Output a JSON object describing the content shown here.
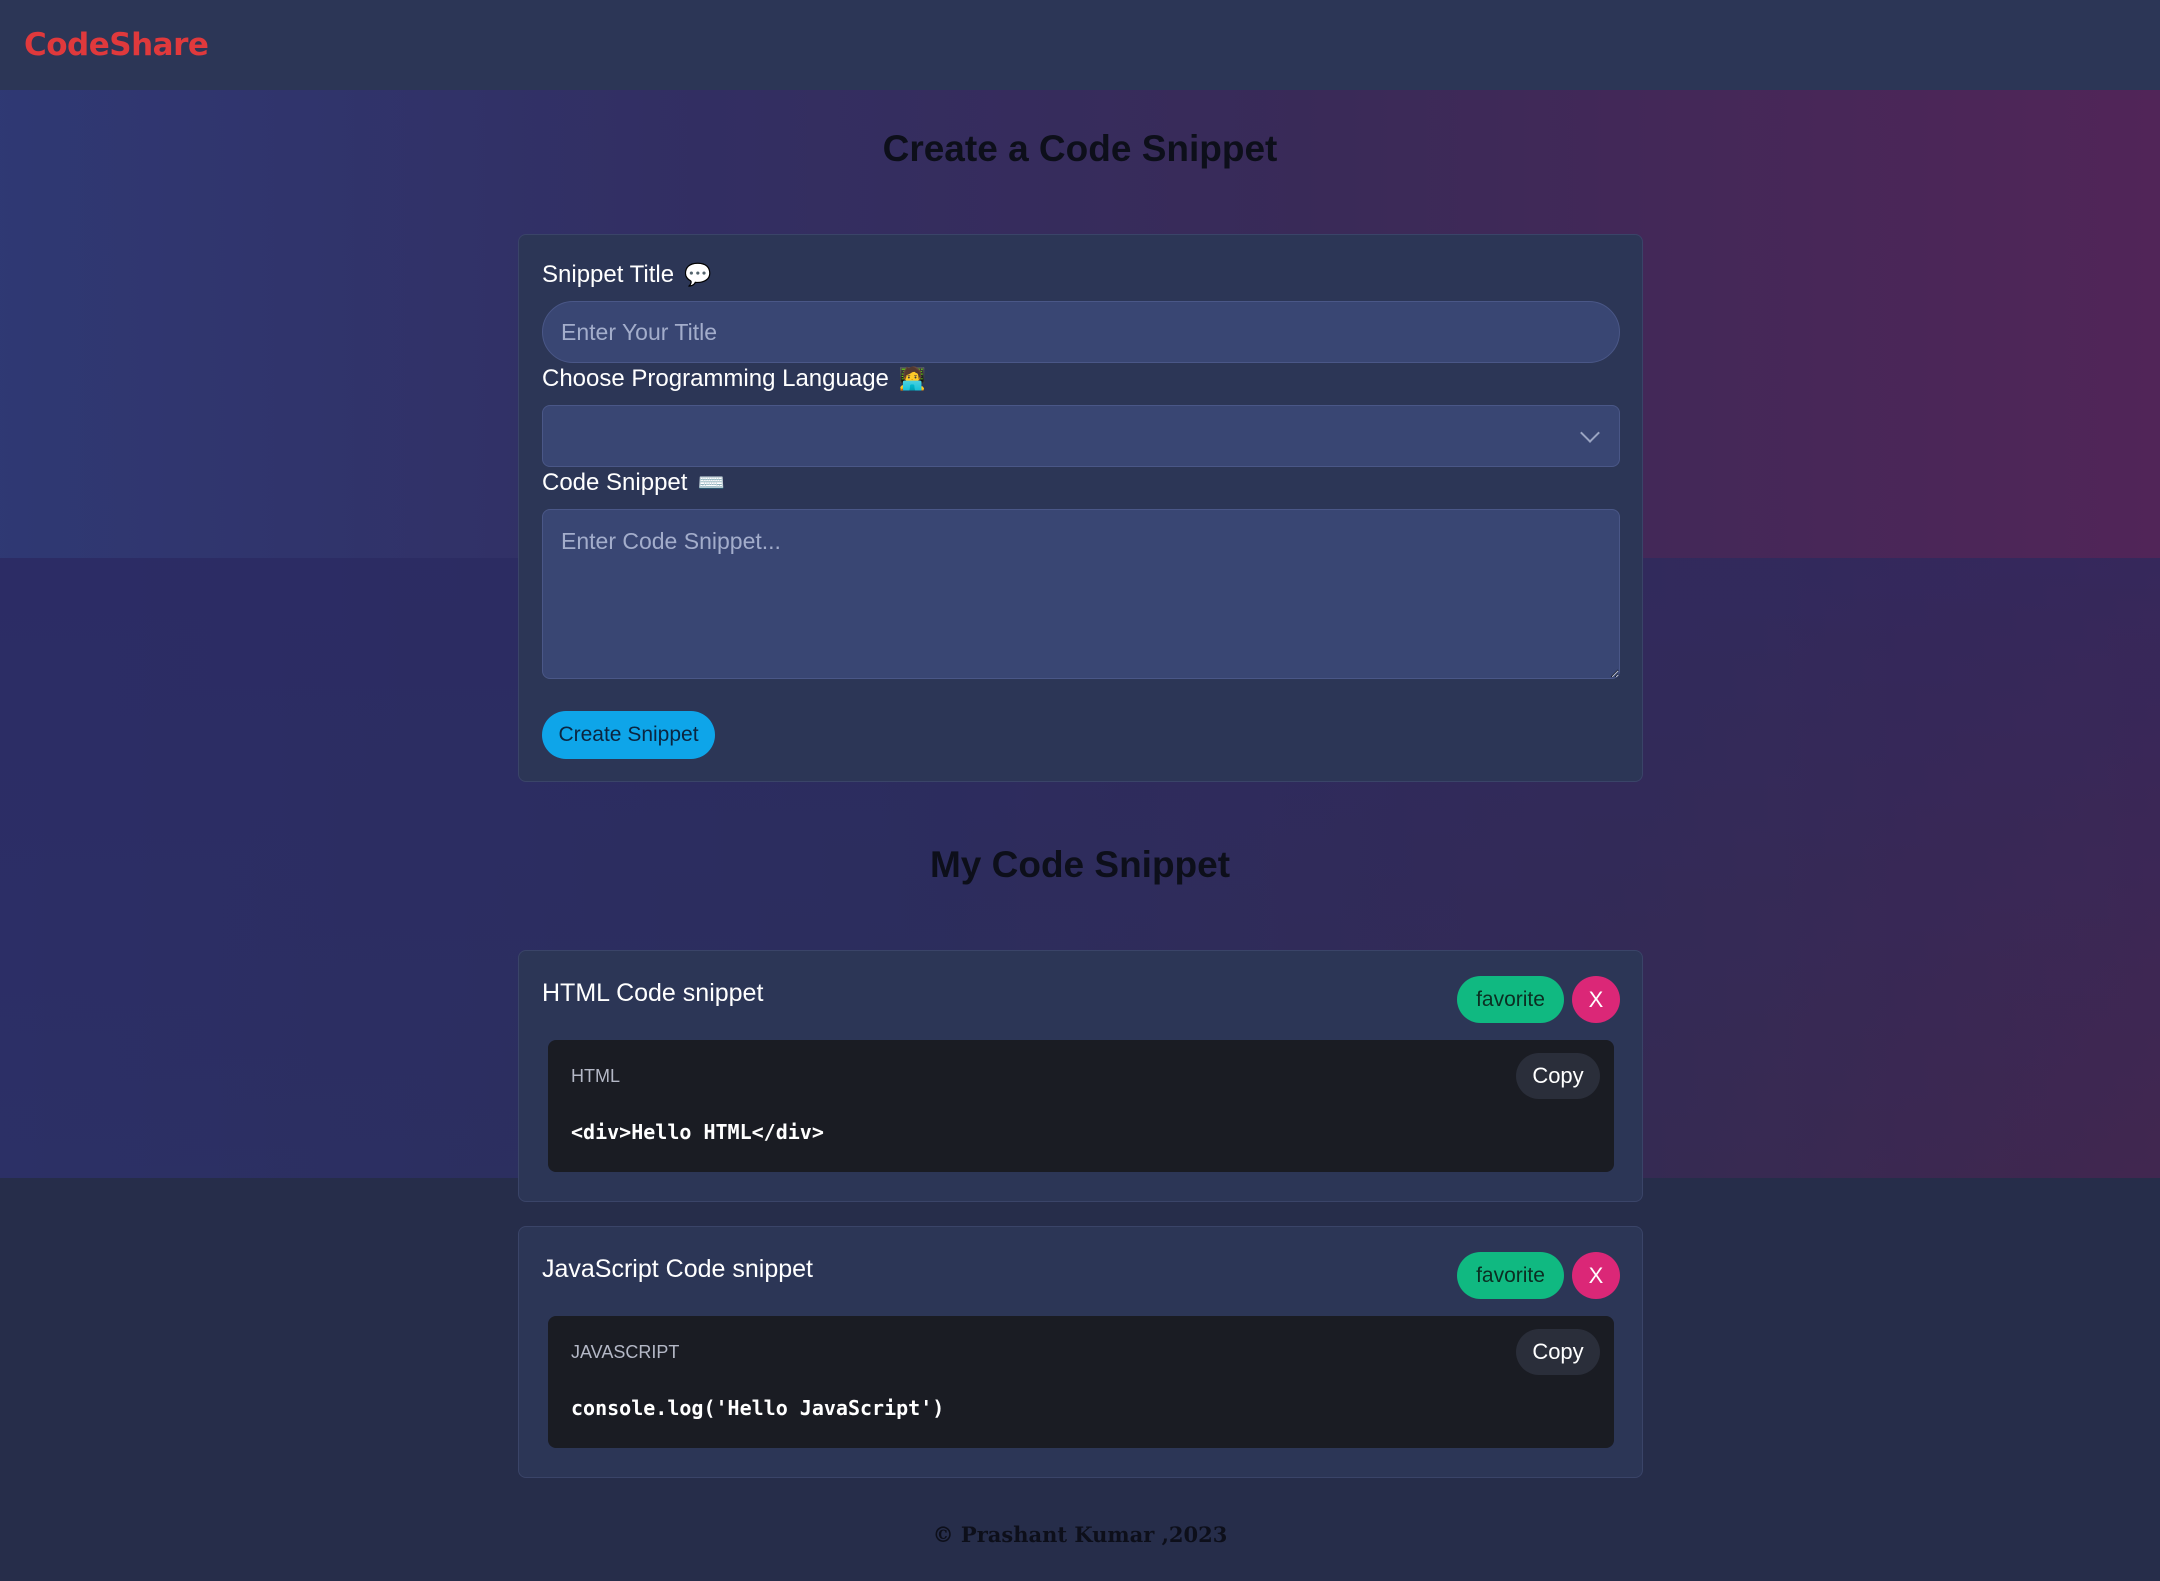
{
  "app": {
    "brand": "CodeShare"
  },
  "create": {
    "heading": "Create a Code Snippet",
    "title_label": "Snippet Title",
    "title_emoji": "💬",
    "title_placeholder": "Enter Your Title",
    "language_label": "Choose Programming Language",
    "language_emoji": "🧑‍💻",
    "language_selected": "",
    "code_label": "Code Snippet",
    "code_emoji": "⌨️",
    "code_placeholder": "Enter Code Snippet...",
    "submit_label": "Create Snippet"
  },
  "list": {
    "heading": "My Code Snippet",
    "snippets": [
      {
        "title": "HTML Code snippet",
        "language": "HTML",
        "code": "<div>Hello HTML</div>",
        "favorite_label": "favorite",
        "delete_label": "X",
        "copy_label": "Copy"
      },
      {
        "title": "JavaScript Code snippet",
        "language": "JAVASCRIPT",
        "code": "console.log('Hello JavaScript')",
        "favorite_label": "favorite",
        "delete_label": "X",
        "copy_label": "Copy"
      }
    ]
  },
  "footer": {
    "text": "© Prashant Kumar ,2023"
  },
  "colors": {
    "brand": "#e0393c",
    "primary_button": "#0ea5e9",
    "favorite_button": "#10b981",
    "delete_button": "#db2777",
    "card_bg": "#2c3656",
    "input_bg": "#394673",
    "code_bg": "#1a1c23"
  }
}
